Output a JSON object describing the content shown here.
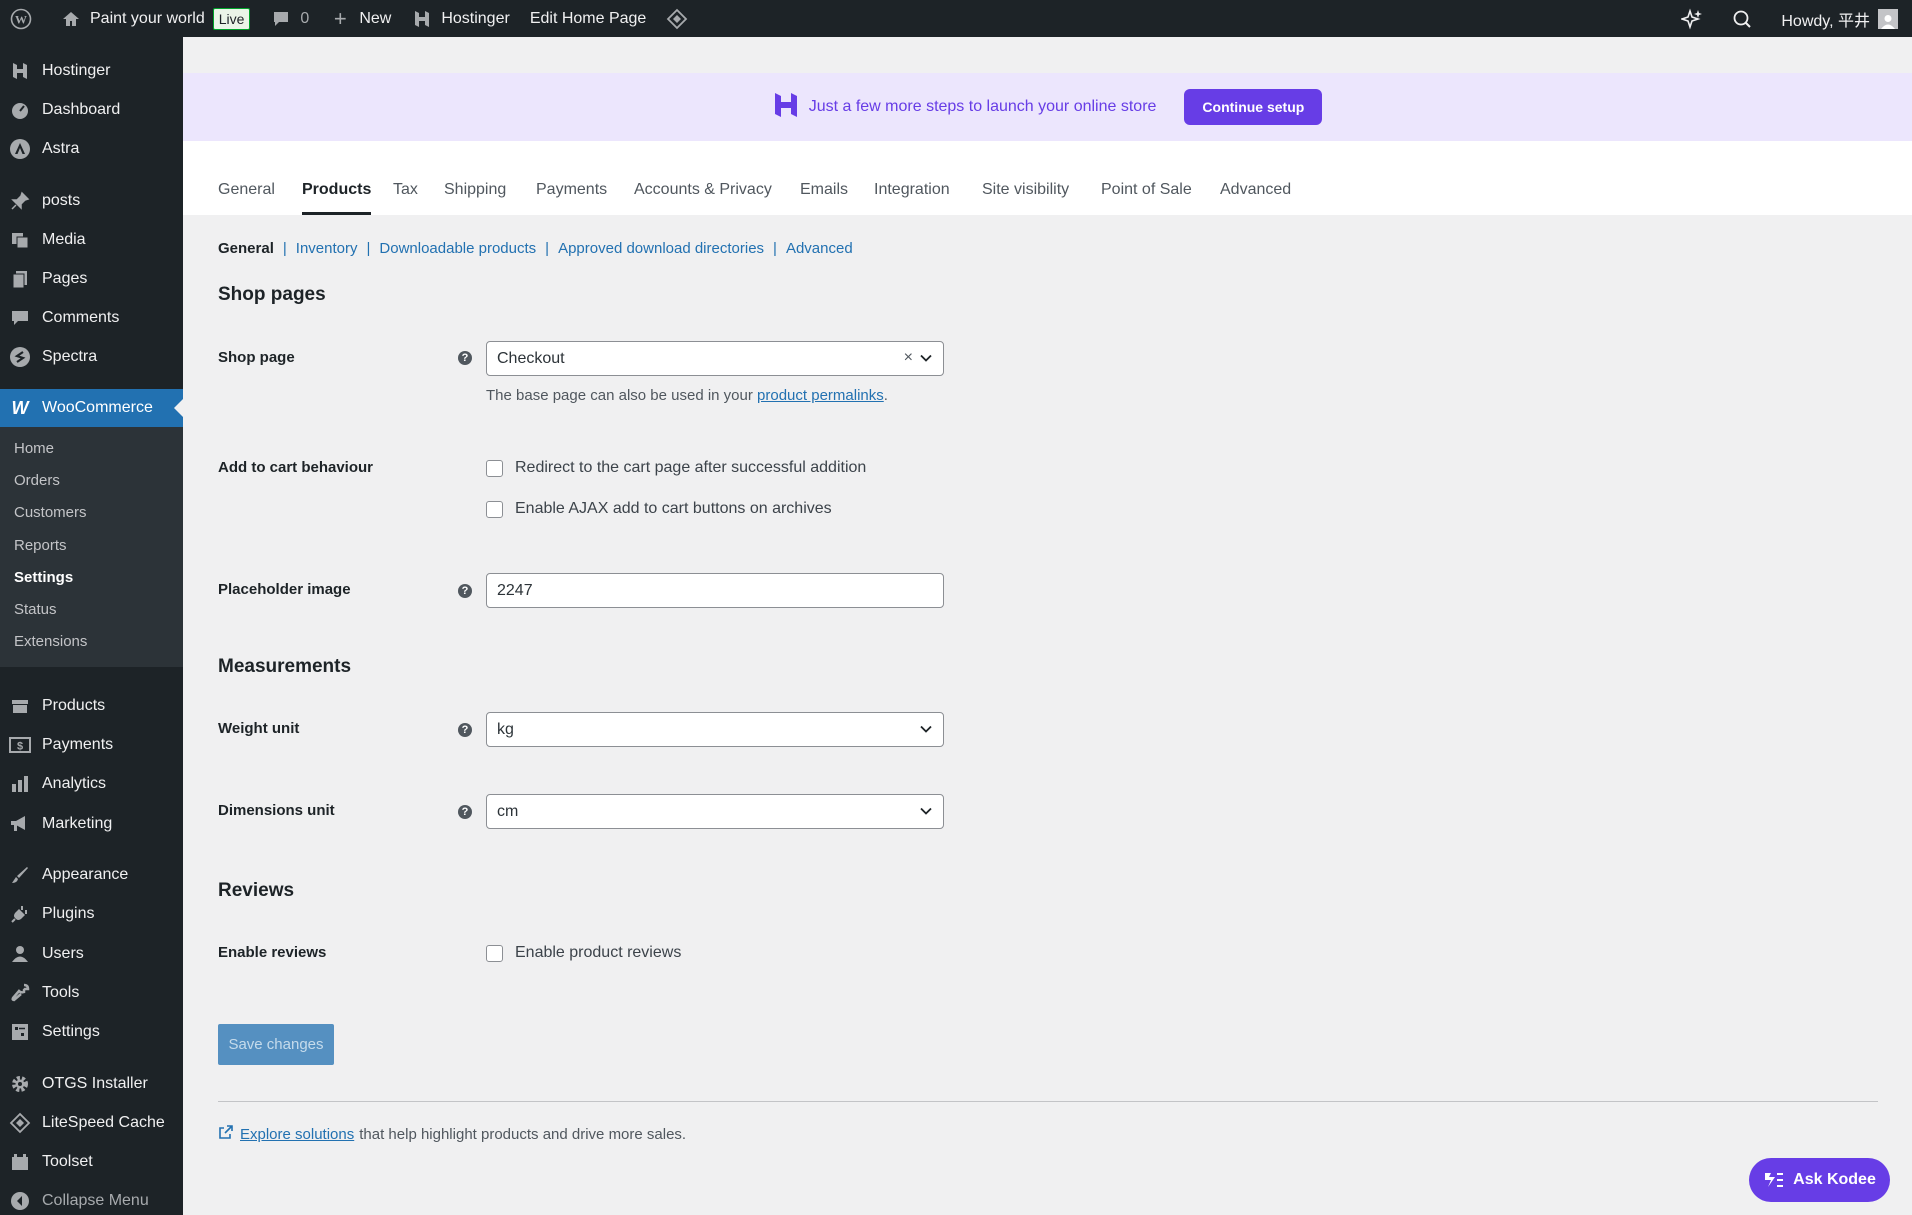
{
  "admin_bar": {
    "site_name": "Paint your world",
    "live_badge": "Live",
    "comments_count": "0",
    "new_label": "New",
    "hostinger_label": "Hostinger",
    "edit_label": "Edit Home Page",
    "howdy": "Howdy, 平井"
  },
  "sidebar": {
    "items": [
      {
        "label": "Hostinger",
        "icon": "hostinger-icon"
      },
      {
        "label": "Dashboard",
        "icon": "dashboard-icon"
      },
      {
        "label": "Astra",
        "icon": "astra-icon"
      },
      {
        "label": "posts",
        "icon": "pin-icon"
      },
      {
        "label": "Media",
        "icon": "media-icon"
      },
      {
        "label": "Pages",
        "icon": "pages-icon"
      },
      {
        "label": "Comments",
        "icon": "comments-icon"
      },
      {
        "label": "Spectra",
        "icon": "spectra-icon"
      },
      {
        "label": "WooCommerce",
        "icon": "woocommerce-icon"
      },
      {
        "label": "Products",
        "icon": "products-icon"
      },
      {
        "label": "Payments",
        "icon": "payments-icon"
      },
      {
        "label": "Analytics",
        "icon": "analytics-icon"
      },
      {
        "label": "Marketing",
        "icon": "megaphone-icon"
      },
      {
        "label": "Appearance",
        "icon": "brush-icon"
      },
      {
        "label": "Plugins",
        "icon": "plug-icon"
      },
      {
        "label": "Users",
        "icon": "user-icon"
      },
      {
        "label": "Tools",
        "icon": "wrench-icon"
      },
      {
        "label": "Settings",
        "icon": "settings-icon"
      },
      {
        "label": "OTGS Installer",
        "icon": "gear-icon"
      },
      {
        "label": "LiteSpeed Cache",
        "icon": "diamond-icon"
      },
      {
        "label": "Toolset",
        "icon": "toolset-icon"
      },
      {
        "label": "Collapse Menu",
        "icon": "collapse-icon"
      }
    ],
    "woo_submenu": [
      "Home",
      "Orders",
      "Customers",
      "Reports",
      "Settings",
      "Status",
      "Extensions"
    ]
  },
  "banner": {
    "text": "Just a few more steps to launch your online store",
    "button": "Continue setup"
  },
  "tabs": [
    "General",
    "Products",
    "Tax",
    "Shipping",
    "Payments",
    "Accounts & Privacy",
    "Emails",
    "Integration",
    "Site visibility",
    "Point of Sale",
    "Advanced"
  ],
  "subnav": [
    "General",
    "Inventory",
    "Downloadable products",
    "Approved download directories",
    "Advanced"
  ],
  "shop_pages": {
    "heading": "Shop pages",
    "shop_page_label": "Shop page",
    "shop_page_value": "Checkout",
    "shop_page_desc": "The base page can also be used in your",
    "shop_page_link": "product permalinks",
    "add_to_cart_label": "Add to cart behaviour",
    "cb_redirect": "Redirect to the cart page after successful addition",
    "cb_ajax": "Enable AJAX add to cart buttons on archives",
    "placeholder_label": "Placeholder image",
    "placeholder_value": "2247"
  },
  "measurements": {
    "heading": "Measurements",
    "weight_label": "Weight unit",
    "weight_value": "kg",
    "dimensions_label": "Dimensions unit",
    "dimensions_value": "cm"
  },
  "reviews": {
    "heading": "Reviews",
    "enable_label": "Enable reviews",
    "cb_enable": "Enable product reviews"
  },
  "save_button": "Save changes",
  "footer": {
    "link": "Explore solutions",
    "text": "that help highlight products and drive more sales."
  },
  "ask_kodee": "Ask Kodee"
}
